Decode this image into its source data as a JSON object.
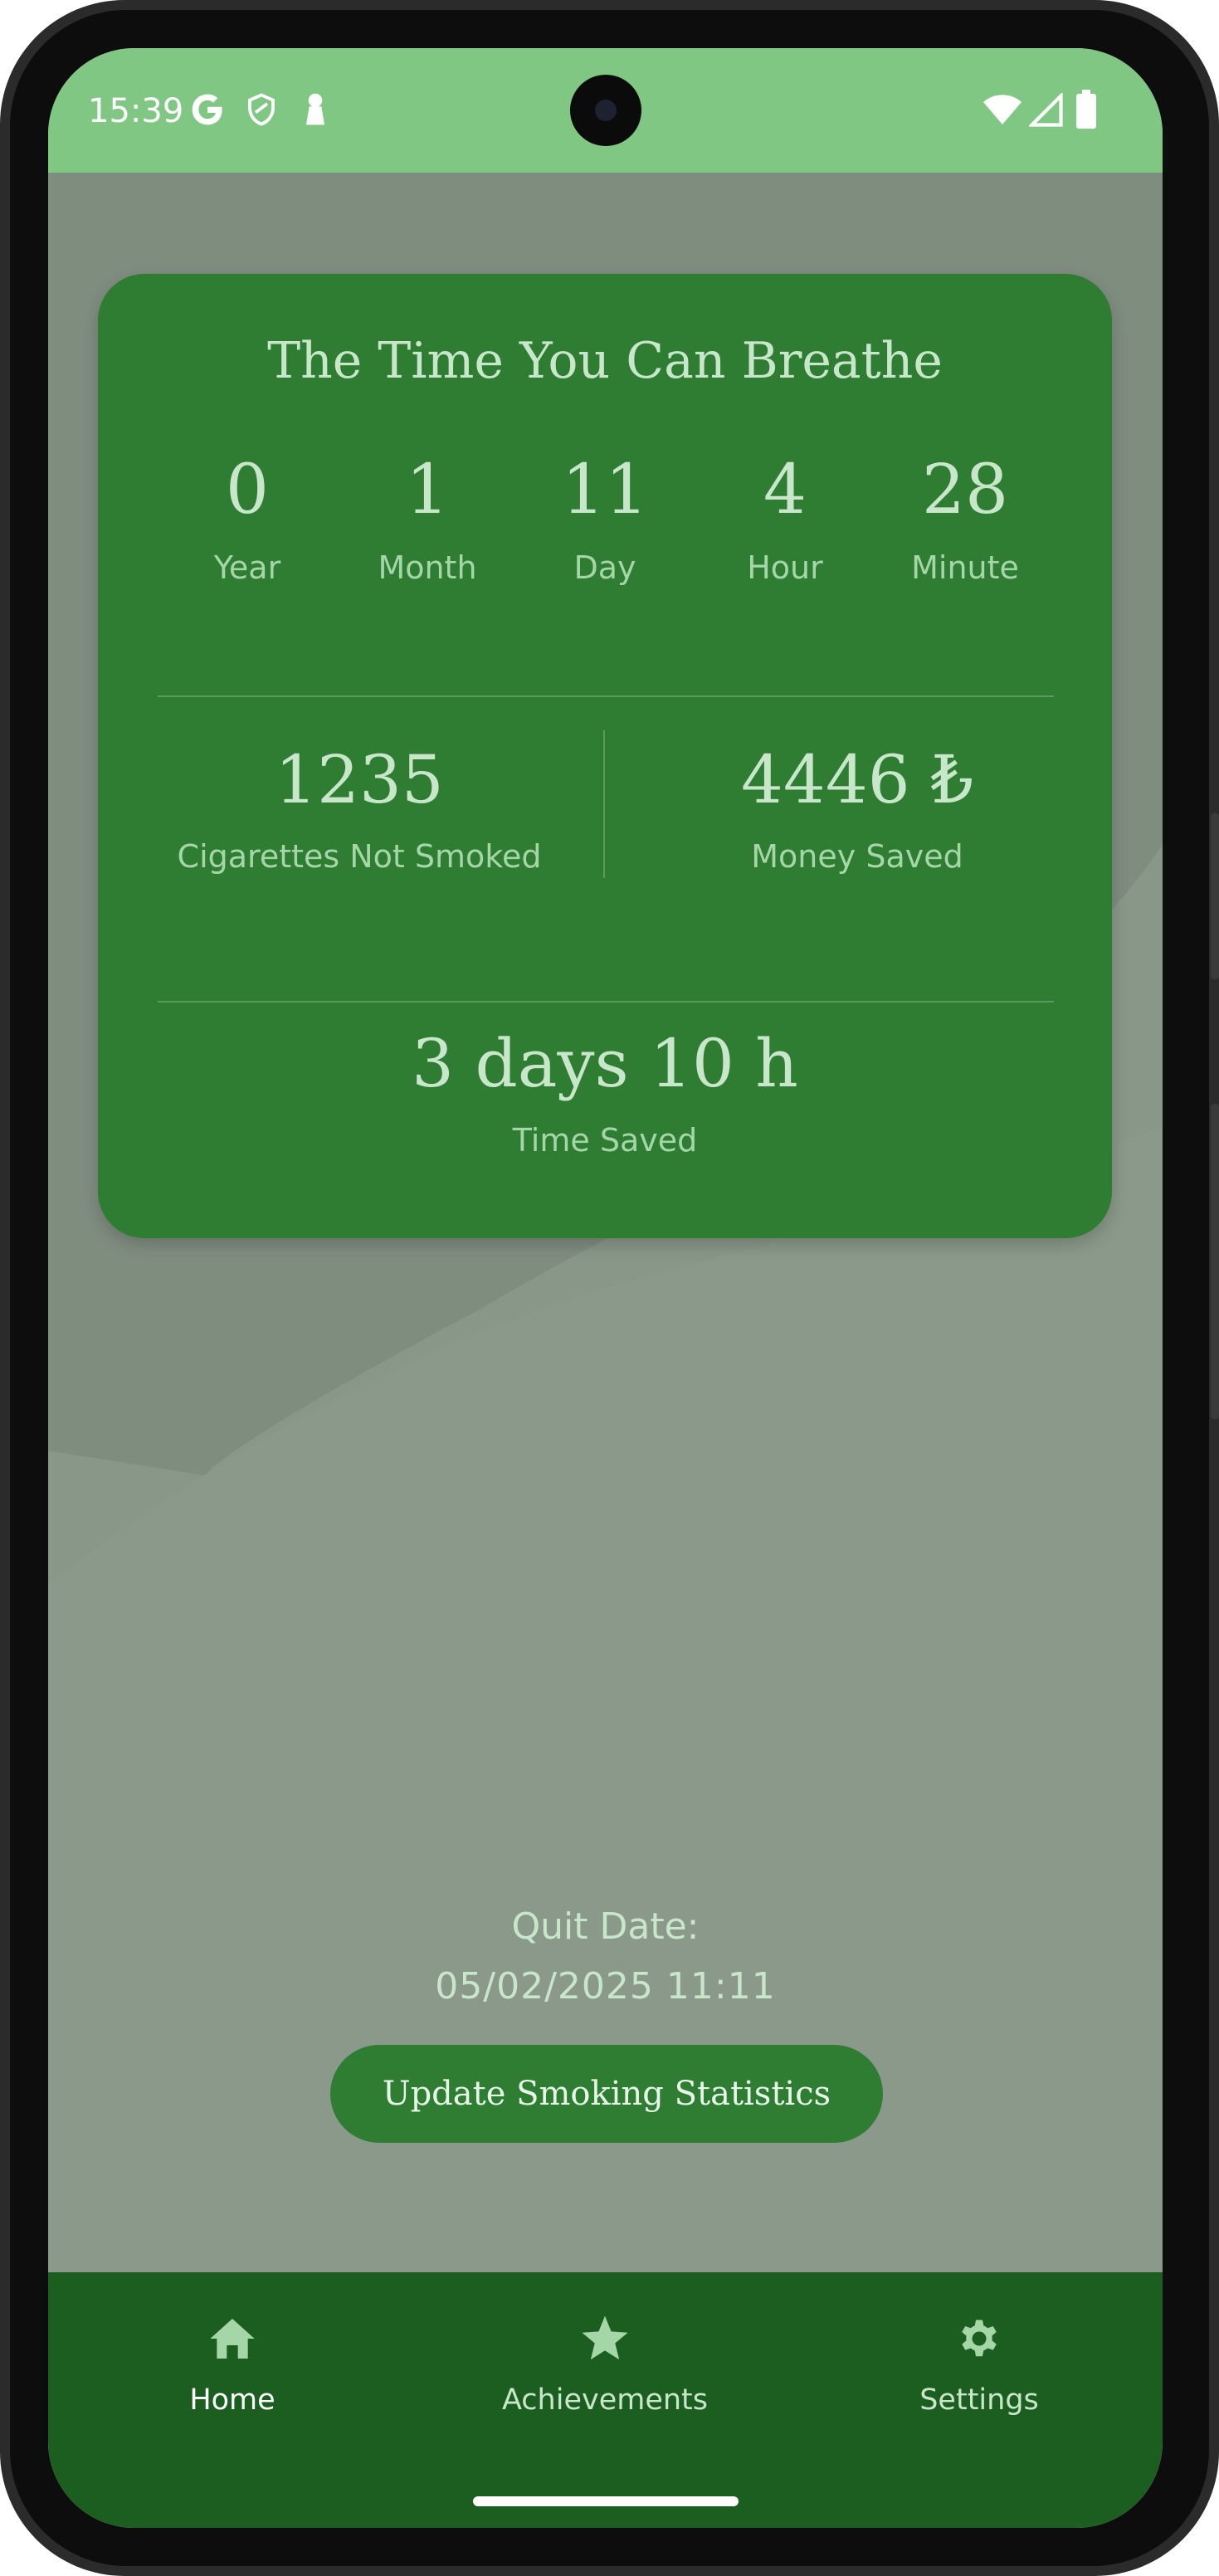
{
  "status_bar": {
    "time": "15:39",
    "left_icons": [
      "google-icon",
      "shield-icon",
      "keyhole-icon"
    ],
    "right_icons": [
      "wifi-icon",
      "cellular-signal-icon",
      "battery-icon"
    ],
    "background": "#81c784"
  },
  "card": {
    "title": "The Time You Can Breathe",
    "elapsed": [
      {
        "value": "0",
        "unit": "Year"
      },
      {
        "value": "1",
        "unit": "Month"
      },
      {
        "value": "11",
        "unit": "Day"
      },
      {
        "value": "4",
        "unit": "Hour"
      },
      {
        "value": "28",
        "unit": "Minute"
      }
    ],
    "cigarettes": {
      "value": "1235",
      "label": "Cigarettes Not Smoked"
    },
    "money": {
      "value": "4446 ₺",
      "label": "Money Saved"
    },
    "time_saved": {
      "value": "3 days 10 h",
      "label": "Time Saved"
    },
    "background": "#2e7d32"
  },
  "quit": {
    "label": "Quit Date:",
    "date": "05/02/2025 11:11"
  },
  "update_button": {
    "label": "Update Smoking Statistics"
  },
  "bottom_nav": {
    "items": [
      {
        "label": "Home",
        "icon": "home-icon",
        "active": true
      },
      {
        "label": "Achievements",
        "icon": "star-icon",
        "active": false
      },
      {
        "label": "Settings",
        "icon": "gear-icon",
        "active": false
      }
    ],
    "background": "#1b5e20",
    "active_color": "#ffffff",
    "inactive_color": "#c8e6c9",
    "icon_color": "#a5d6a7"
  }
}
